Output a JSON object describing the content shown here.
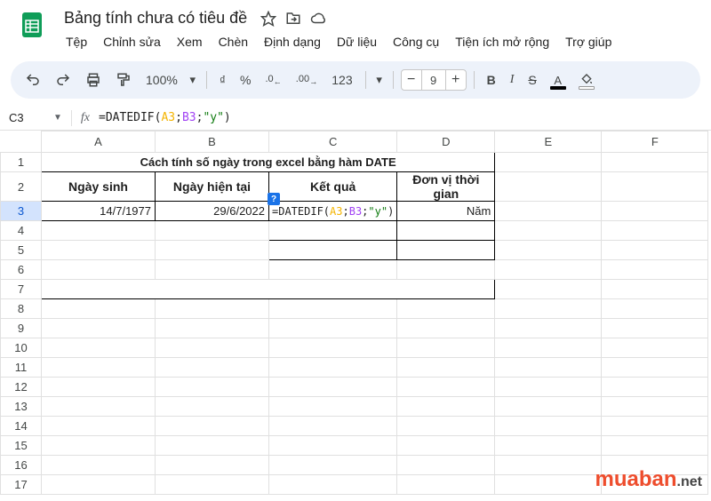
{
  "doc": {
    "title": "Bảng tính chưa có tiêu đề"
  },
  "menu": {
    "file": "Tệp",
    "edit": "Chỉnh sửa",
    "view": "Xem",
    "insert": "Chèn",
    "format": "Định dạng",
    "data": "Dữ liệu",
    "tools": "Công cụ",
    "extensions": "Tiện ích mở rộng",
    "help": "Trợ giúp"
  },
  "toolbar": {
    "zoom": "100%",
    "currency": "₫",
    "percent": "%",
    "decDec": ".0",
    "incDec": ".00",
    "numFormat": "123",
    "fontSize": "9",
    "bold": "B",
    "italic": "I",
    "strike": "S",
    "textColor": "A"
  },
  "nameBox": "C3",
  "formula": {
    "prefix": "=DATEDIF(",
    "arg1": "A3",
    "sep1": ";",
    "arg2": "B3",
    "sep2": ";",
    "arg3": "\"y\"",
    "suffix": ")"
  },
  "columns": [
    "A",
    "B",
    "C",
    "D",
    "E",
    "F"
  ],
  "rowNumbers": [
    "1",
    "2",
    "3",
    "4",
    "5",
    "6",
    "7",
    "8",
    "9",
    "10",
    "11",
    "12",
    "13",
    "14",
    "15",
    "16",
    "17"
  ],
  "sheet": {
    "titleRow": "Cách tính số ngày trong excel bằng hàm DATE",
    "headers": {
      "a": "Ngày sinh",
      "b": "Ngày hiện tại",
      "c": "Kết quả",
      "d": "Đơn vị thời gian"
    },
    "row3": {
      "a": "14/7/1977",
      "b": "29/6/2022",
      "d": "Năm"
    }
  },
  "cellFormula": {
    "prefix": "=DATEDIF(",
    "arg1": "A3",
    "sep1": ";",
    "arg2": "B3",
    "sep2": ";",
    "arg3": "\"y\"",
    "suffix": ")"
  },
  "watermark": {
    "brand": "muaban",
    "suffix": ".net"
  }
}
